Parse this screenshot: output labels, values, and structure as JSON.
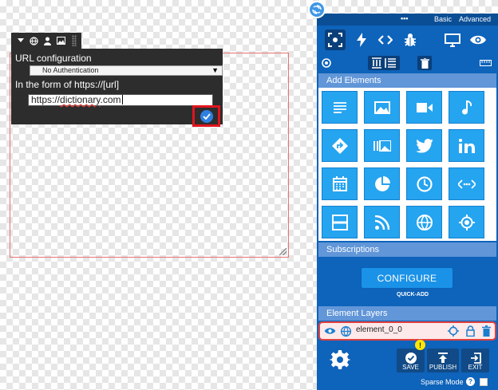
{
  "popup": {
    "url_config_label": "URL configuration",
    "auth_select_value": "No Authentication",
    "url_form_label": "In the form of https://[url]",
    "url_value_prefix": "https://",
    "url_value_main": "dictionary",
    "url_value_suffix": ".com"
  },
  "mode_bar": {
    "dots": "•••",
    "basic_label": "Basic",
    "advanced_label": "Advanced"
  },
  "sections": {
    "add_elements": "Add Elements",
    "subscriptions": "Subscriptions",
    "element_layers": "Element Layers"
  },
  "subscriptions": {
    "configure_label": "CONFIGURE",
    "quick_add_label": "QUICK-ADD"
  },
  "layers": [
    {
      "name": "element_0_0"
    }
  ],
  "actions": {
    "save_label": "SAVE",
    "publish_label": "PUBLISH",
    "exit_label": "EXIT",
    "save_badge": "!"
  },
  "sparse_mode": {
    "label": "Sparse Mode",
    "help": "?"
  },
  "element_tiles": [
    "text-icon",
    "image-icon",
    "video-icon",
    "music-icon",
    "directions-icon",
    "gallery-icon",
    "twitter-icon",
    "linkedin-icon",
    "calendar-icon",
    "pie-chart-icon",
    "clock-icon",
    "embed-code-icon",
    "divider-icon",
    "rss-icon",
    "globe-icon",
    "location-target-icon"
  ],
  "colors": {
    "panel_bg": "#0e63ba",
    "section_header": "#6196d8",
    "tile": "#25a4f0",
    "highlight": "#e0141e",
    "layer_bg": "#fde9ea"
  }
}
